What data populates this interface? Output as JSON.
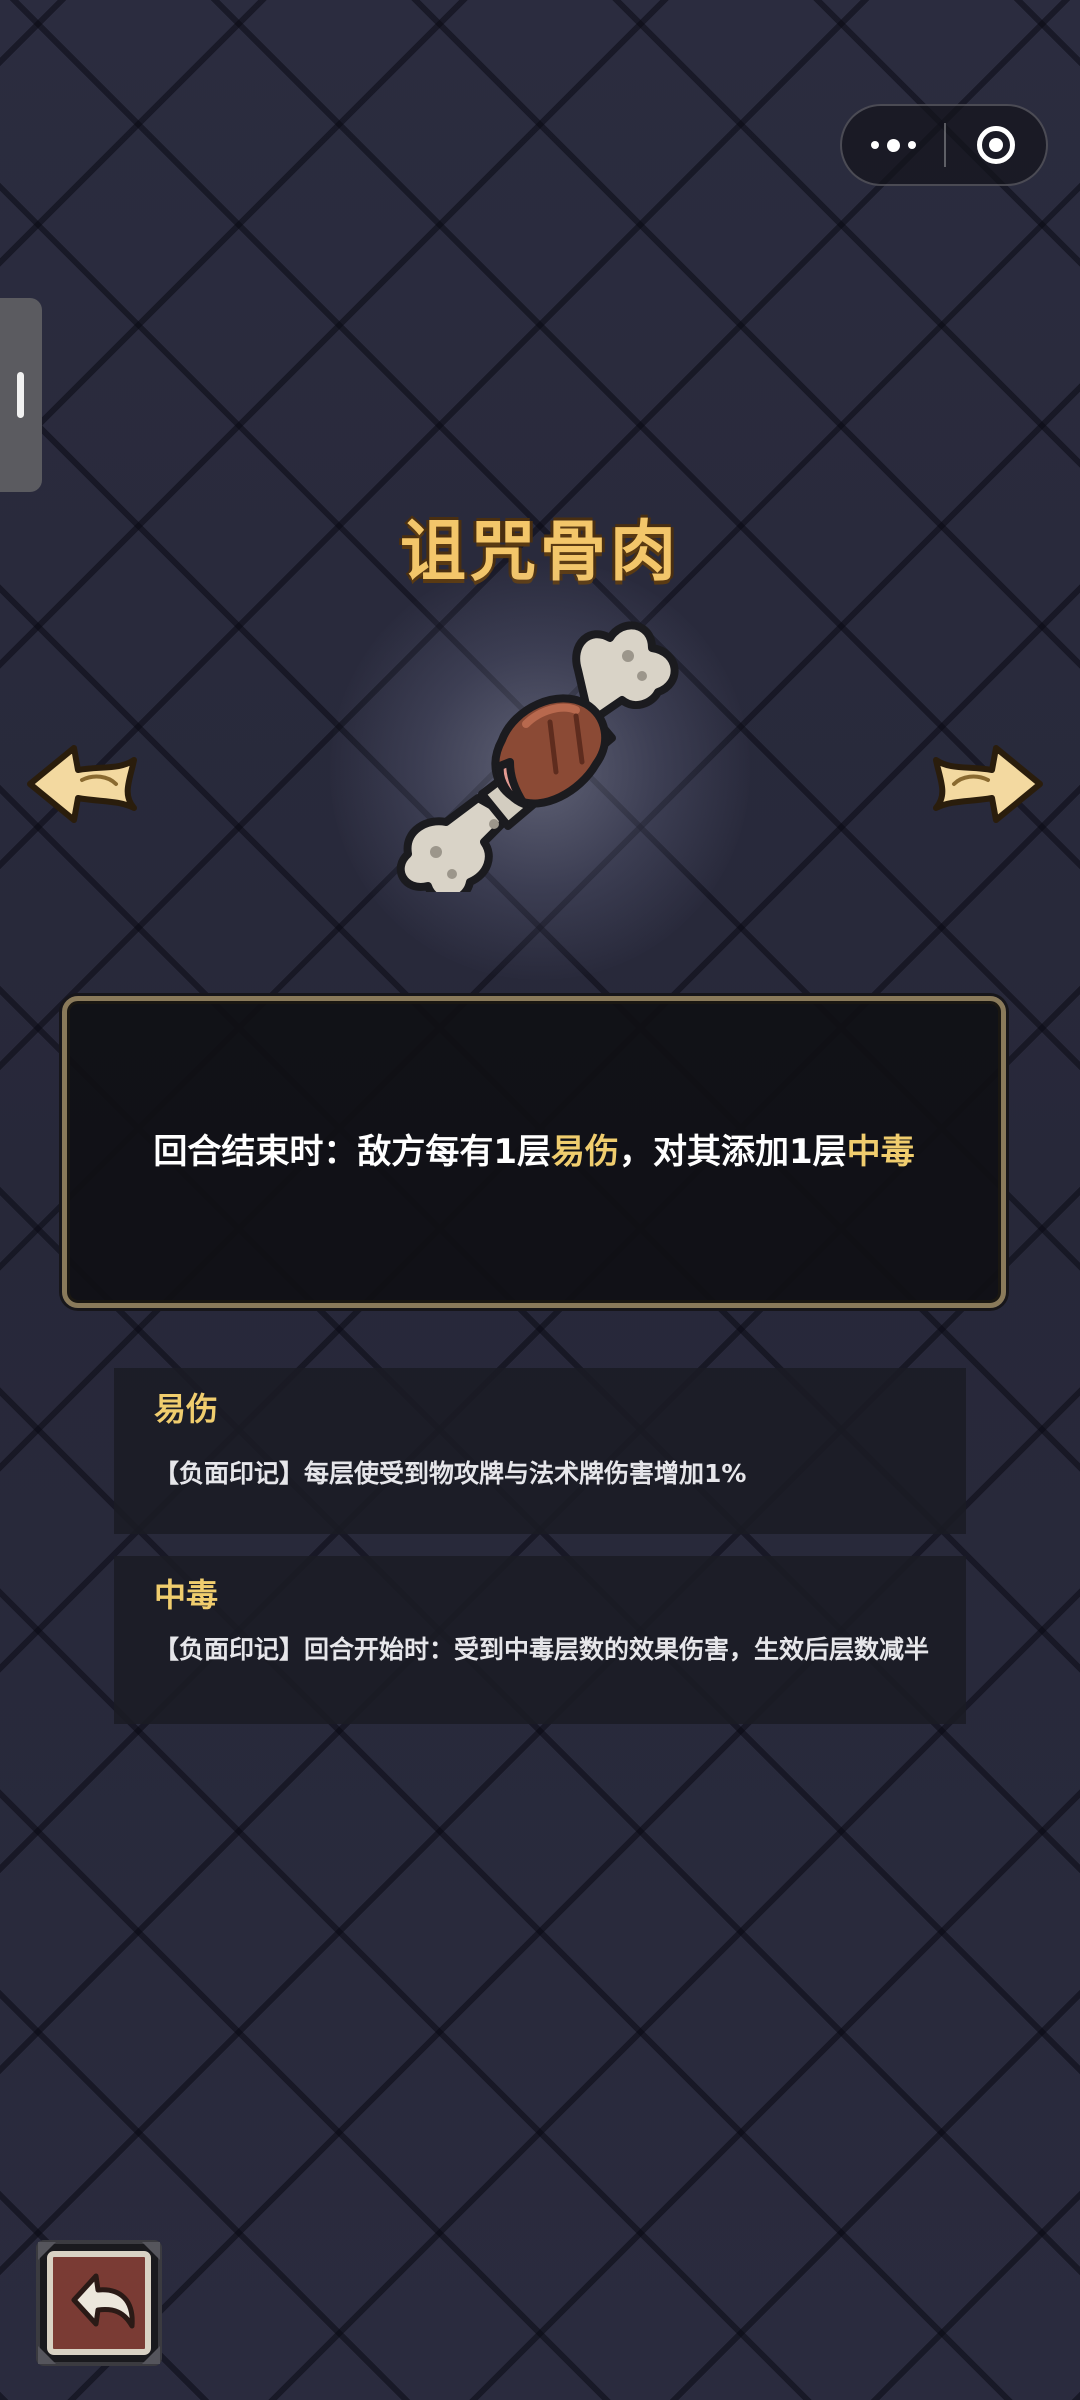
{
  "capsule": {
    "more_icon": "more-dots-icon",
    "close_icon": "target-circle-icon"
  },
  "item": {
    "title": "诅咒骨肉",
    "icon": "cursed-bone-meat-icon",
    "description": {
      "part1": "回合结束时：敌方每有1层",
      "keyword1": "易伤",
      "part2": "，对其添加1层",
      "keyword2": "中毒"
    }
  },
  "navigation": {
    "prev_icon": "arrow-left-icon",
    "next_icon": "arrow-right-icon"
  },
  "keywords": [
    {
      "name": "易伤",
      "description": "【负面印记】每层使受到物攻牌与法术牌伤害增加1%"
    },
    {
      "name": "中毒",
      "description": "【负面印记】回合开始时：受到中毒层数的效果伤害，生效后层数减半"
    }
  ],
  "back_button": {
    "icon": "back-arrow-icon"
  },
  "colors": {
    "title": "#f3c66a",
    "highlight": "#f0cd6e",
    "background": "#2a2b3d",
    "panel_border": "#8a7a5a"
  }
}
